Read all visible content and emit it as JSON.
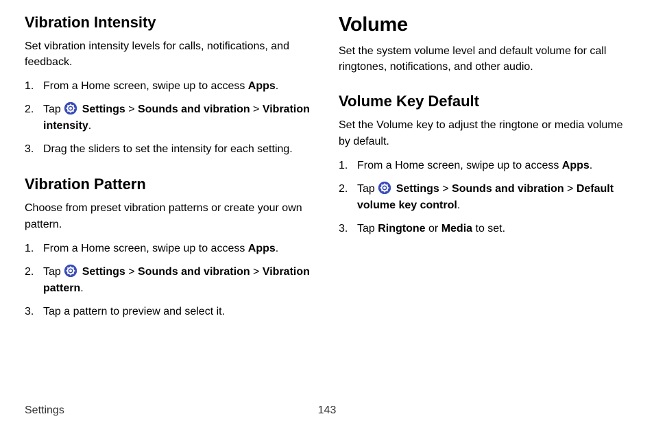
{
  "left": {
    "vibration_intensity": {
      "title": "Vibration Intensity",
      "desc": "Set vibration intensity levels for calls, notifications, and feedback.",
      "steps": {
        "s1_pre": "From a Home screen, swipe up to access ",
        "s1_bold": "Apps",
        "s1_post": ".",
        "s2_tap": "Tap ",
        "s2_settings": " Settings",
        "s2_gt1": " > ",
        "s2_sv": "Sounds and vibration",
        "s2_gt2": " > ",
        "s2_vi": "Vibration intensity",
        "s2_post": ".",
        "s3": "Drag the sliders to set the intensity for each setting."
      }
    },
    "vibration_pattern": {
      "title": "Vibration Pattern",
      "desc": "Choose from preset vibration patterns or create your own pattern.",
      "steps": {
        "s1_pre": "From a Home screen, swipe up to access ",
        "s1_bold": "Apps",
        "s1_post": ".",
        "s2_tap": "Tap ",
        "s2_settings": " Settings",
        "s2_gt1": " > ",
        "s2_sv": "Sounds and vibration",
        "s2_gt2": " > ",
        "s2_vp": "Vibration pattern",
        "s2_post": ".",
        "s3": "Tap a pattern to preview and select it."
      }
    }
  },
  "right": {
    "volume": {
      "title": "Volume",
      "desc": "Set the system volume level and default volume for call ringtones, notifications, and other audio."
    },
    "volume_key_default": {
      "title": "Volume Key Default",
      "desc": "Set the Volume key to adjust the ringtone or media volume by default.",
      "steps": {
        "s1_pre": "From a Home screen, swipe up to access ",
        "s1_bold": "Apps",
        "s1_post": ".",
        "s2_tap": "Tap ",
        "s2_settings": " Settings",
        "s2_gt1": " > ",
        "s2_sv": "Sounds and vibration",
        "s2_gt2": " > ",
        "s2_dvkc": "Default volume key control",
        "s2_post": ".",
        "s3_pre": "Tap ",
        "s3_ringtone": "Ringtone",
        "s3_or": " or ",
        "s3_media": "Media",
        "s3_post": " to set."
      }
    }
  },
  "footer": {
    "section": "Settings",
    "page": "143"
  }
}
